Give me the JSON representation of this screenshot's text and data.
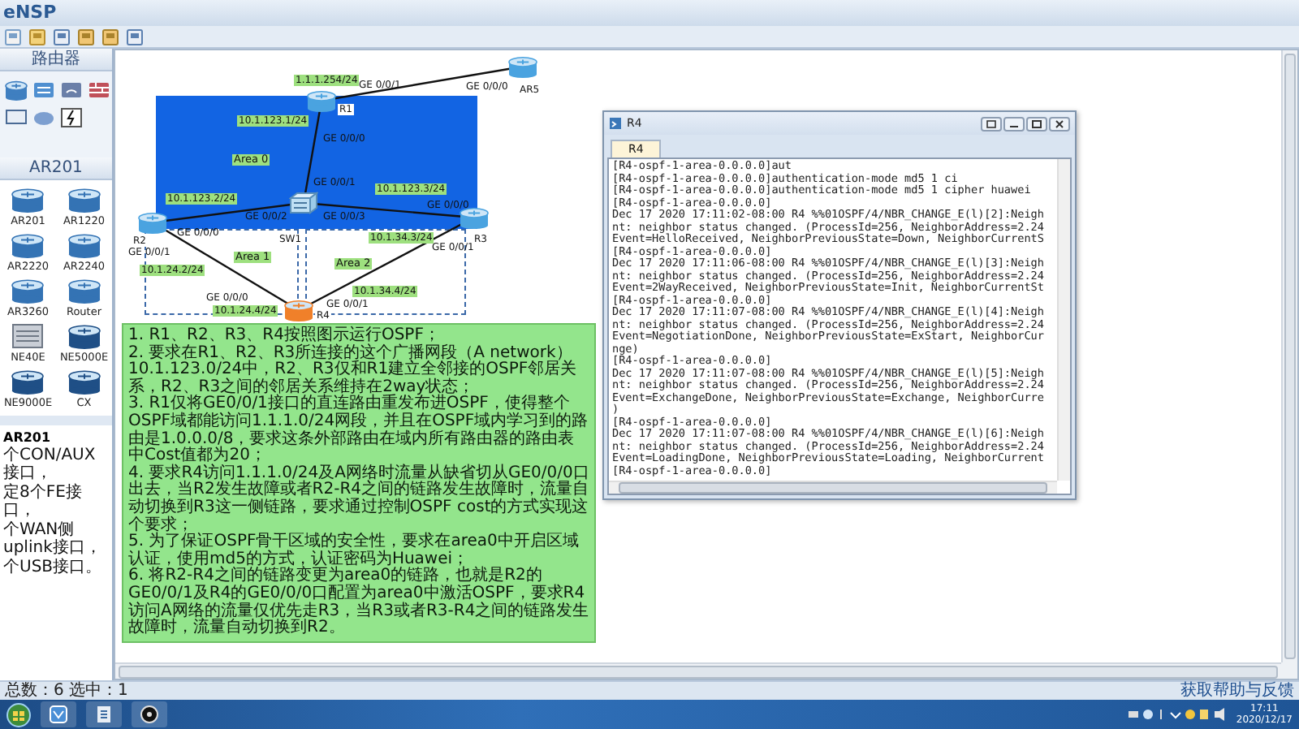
{
  "window": {
    "title": "eNSP"
  },
  "sidebar": {
    "category_title": "路由器",
    "device_title": "AR201",
    "devices": [
      {
        "label": "AR201",
        "kind": "router"
      },
      {
        "label": "AR1220",
        "kind": "router"
      },
      {
        "label": "AR2220",
        "kind": "router"
      },
      {
        "label": "AR2240",
        "kind": "router"
      },
      {
        "label": "AR3260",
        "kind": "router"
      },
      {
        "label": "Router",
        "kind": "router"
      },
      {
        "label": "NE40E",
        "kind": "chassis"
      },
      {
        "label": "NE5000E",
        "kind": "core"
      },
      {
        "label": "NE9000E",
        "kind": "core"
      },
      {
        "label": "CX",
        "kind": "core"
      }
    ],
    "description": {
      "title": "AR201",
      "lines": [
        "个CON/AUX接口，",
        "定8个FE接口，",
        "个WAN侧uplink接口，",
        "个USB接口。"
      ]
    }
  },
  "topology": {
    "areas": [
      {
        "label": "Area 0",
        "kind": "backbone"
      },
      {
        "label": "Area 1",
        "kind": "normal"
      },
      {
        "label": "Area 2",
        "kind": "normal"
      }
    ],
    "nodes": [
      {
        "label": "R1",
        "kind": "router",
        "selected": false
      },
      {
        "label": "AR5",
        "kind": "router",
        "selected": false
      },
      {
        "label": "R2",
        "kind": "router",
        "selected": false
      },
      {
        "label": "SW1",
        "kind": "switch",
        "selected": false
      },
      {
        "label": "R3",
        "kind": "router",
        "selected": false
      },
      {
        "label": "R4",
        "kind": "router",
        "selected": true
      }
    ],
    "labels": [
      {
        "text": "1.1.1.254/24",
        "kind": "address"
      },
      {
        "text": "GE 0/0/1",
        "kind": "port"
      },
      {
        "text": "GE 0/0/0",
        "kind": "port"
      },
      {
        "text": "10.1.123.1/24",
        "kind": "address"
      },
      {
        "text": "GE 0/0/0",
        "kind": "port"
      },
      {
        "text": "GE 0/0/1",
        "kind": "port"
      },
      {
        "text": "10.1.123.2/24",
        "kind": "address"
      },
      {
        "text": "GE 0/0/2",
        "kind": "port"
      },
      {
        "text": "GE 0/0/3",
        "kind": "port"
      },
      {
        "text": "10.1.123.3/24",
        "kind": "address"
      },
      {
        "text": "GE 0/0/0",
        "kind": "port"
      },
      {
        "text": "GE 0/0/0",
        "kind": "port"
      },
      {
        "text": "10.1.34.3/24",
        "kind": "address"
      },
      {
        "text": "GE 0/0/1",
        "kind": "port"
      },
      {
        "text": "GE 0/0/1",
        "kind": "port"
      },
      {
        "text": "10.1.24.2/24",
        "kind": "address"
      },
      {
        "text": "10.1.34.4/24",
        "kind": "address"
      },
      {
        "text": "GE 0/0/0",
        "kind": "port"
      },
      {
        "text": "GE 0/0/1",
        "kind": "port"
      },
      {
        "text": "10.1.24.4/24",
        "kind": "address"
      }
    ]
  },
  "notes": [
    "1. R1、R2、R3、R4按照图示运行OSPF；",
    "2. 要求在R1、R2、R3所连接的这个广播网段（A network）10.1.123.0/24中，R2、R3仅和R1建立全邻接的OSPF邻居关系，R2、R3之间的邻居关系维持在2way状态；",
    "3. R1仅将GE0/0/1接口的直连路由重发布进OSPF，使得整个OSPF域都能访问1.1.1.0/24网段，并且在OSPF域内学习到的路由是1.0.0.0/8，要求这条外部路由在域内所有路由器的路由表中Cost值都为20；",
    "4. 要求R4访问1.1.1.0/24及A网络时流量从缺省切从GE0/0/0口出去，当R2发生故障或者R2-R4之间的链路发生故障时，流量自动切换到R3这一侧链路，要求通过控制OSPF cost的方式实现这个要求；",
    "5. 为了保证OSPF骨干区域的安全性，要求在area0中开启区域认证，使用md5的方式，认证密码为Huawei；",
    "6. 将R2-R4之间的链路变更为area0的链路，也就是R2的GE0/0/1及R4的GE0/0/0口配置为area0中激活OSPF，要求R4访问A网络的流量仅优先走R3，当R3或者R3-R4之间的链路发生故障时，流量自动切换到R2。"
  ],
  "terminal": {
    "title": "R4",
    "tabs": [
      {
        "label": "R4",
        "selected": true
      }
    ],
    "lines": [
      "[R4-ospf-1-area-0.0.0.0]aut",
      "[R4-ospf-1-area-0.0.0.0]authentication-mode md5 1 ci",
      "[R4-ospf-1-area-0.0.0.0]authentication-mode md5 1 cipher huawei",
      "[R4-ospf-1-area-0.0.0.0]",
      "Dec 17 2020 17:11:02-08:00 R4 %%01OSPF/4/NBR_CHANGE_E(l)[2]:Neigh",
      "nt: neighbor status changed. (ProcessId=256, NeighborAddress=2.24",
      "Event=HelloReceived, NeighborPreviousState=Down, NeighborCurrentS",
      "[R4-ospf-1-area-0.0.0.0]",
      "Dec 17 2020 17:11:06-08:00 R4 %%01OSPF/4/NBR_CHANGE_E(l)[3]:Neigh",
      "nt: neighbor status changed. (ProcessId=256, NeighborAddress=2.24",
      "Event=2WayReceived, NeighborPreviousState=Init, NeighborCurrentSt",
      "[R4-ospf-1-area-0.0.0.0]",
      "Dec 17 2020 17:11:07-08:00 R4 %%01OSPF/4/NBR_CHANGE_E(l)[4]:Neigh",
      "nt: neighbor status changed. (ProcessId=256, NeighborAddress=2.24",
      "Event=NegotiationDone, NeighborPreviousState=ExStart, NeighborCur",
      "nge)",
      "[R4-ospf-1-area-0.0.0.0]",
      "Dec 17 2020 17:11:07-08:00 R4 %%01OSPF/4/NBR_CHANGE_E(l)[5]:Neigh",
      "nt: neighbor status changed. (ProcessId=256, NeighborAddress=2.24",
      "Event=ExchangeDone, NeighborPreviousState=Exchange, NeighborCurre",
      ")",
      "[R4-ospf-1-area-0.0.0.0]",
      "Dec 17 2020 17:11:07-08:00 R4 %%01OSPF/4/NBR_CHANGE_E(l)[6]:Neigh",
      "nt: neighbor status changed. (ProcessId=256, NeighborAddress=2.24",
      "Event=LoadingDone, NeighborPreviousState=Loading, NeighborCurrent",
      "[R4-ospf-1-area-0.0.0.0]"
    ]
  },
  "status_bar": {
    "left": "总数：6 选中：1",
    "right": "获取帮助与反馈"
  },
  "taskbar": {
    "time": "17:11",
    "date": "2020/12/17"
  }
}
